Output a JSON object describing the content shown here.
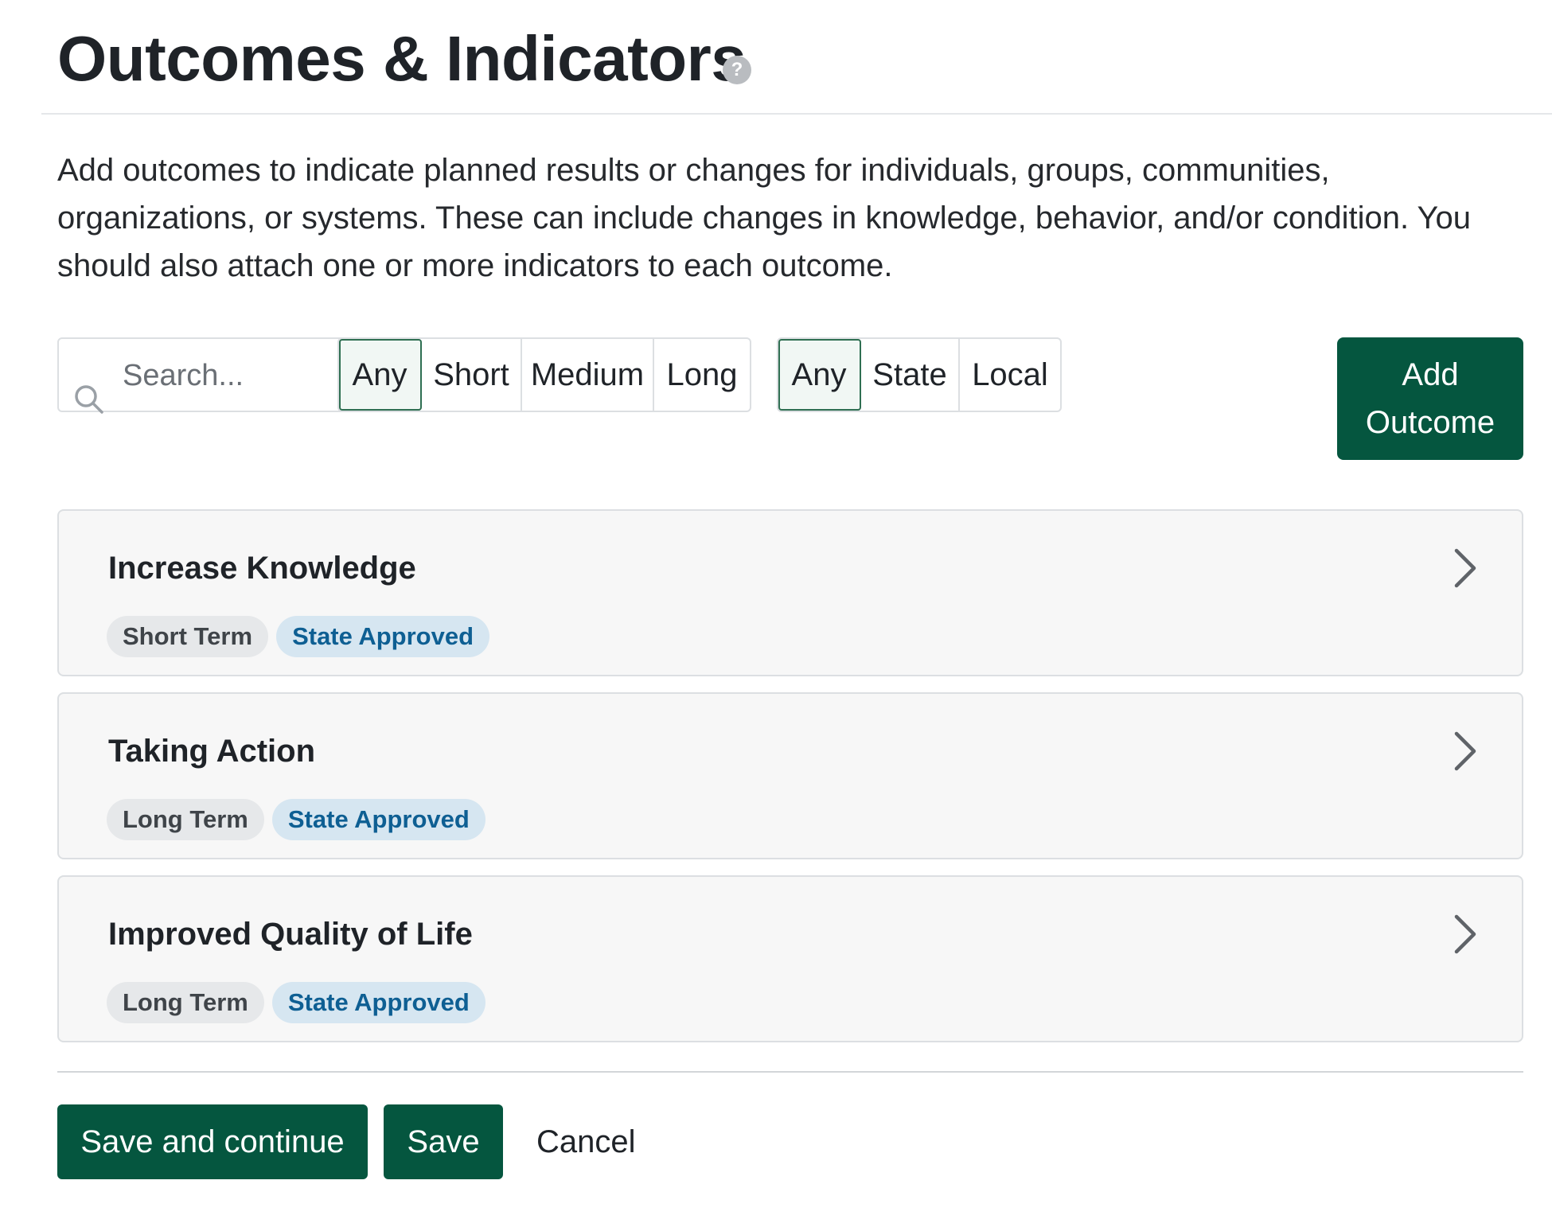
{
  "header": {
    "title": "Outcomes & Indicators",
    "help_icon": "question-circle-icon",
    "help_glyph": "?"
  },
  "intro": {
    "text": "Add outcomes to indicate planned results or changes for individuals, groups, communities, organizations, or systems. These can include changes in knowledge, behavior, and/or condition. You should also attach one or more indicators to each outcome."
  },
  "filters": {
    "search": {
      "placeholder": "Search...",
      "value": ""
    },
    "term": {
      "options": [
        "Any",
        "Short",
        "Medium",
        "Long"
      ],
      "selected": "Any"
    },
    "approval": {
      "options": [
        "Any",
        "State",
        "Local"
      ],
      "selected": "Any"
    },
    "add_button_label": "Add Outcome"
  },
  "outcomes": [
    {
      "title": "Increase Knowledge",
      "term": "Short Term",
      "status": "State Approved"
    },
    {
      "title": "Taking Action",
      "term": "Long Term",
      "status": "State Approved"
    },
    {
      "title": "Improved Quality of Life",
      "term": "Long Term",
      "status": "State Approved"
    }
  ],
  "footer": {
    "save_continue_label": "Save and continue",
    "save_label": "Save",
    "cancel_label": "Cancel"
  },
  "colors": {
    "primary": "#05563f",
    "status_pill_bg": "#d6e6f1",
    "status_pill_text": "#0e5f93",
    "term_pill_bg": "#e6e8ea",
    "card_bg": "#f7f7f7"
  }
}
